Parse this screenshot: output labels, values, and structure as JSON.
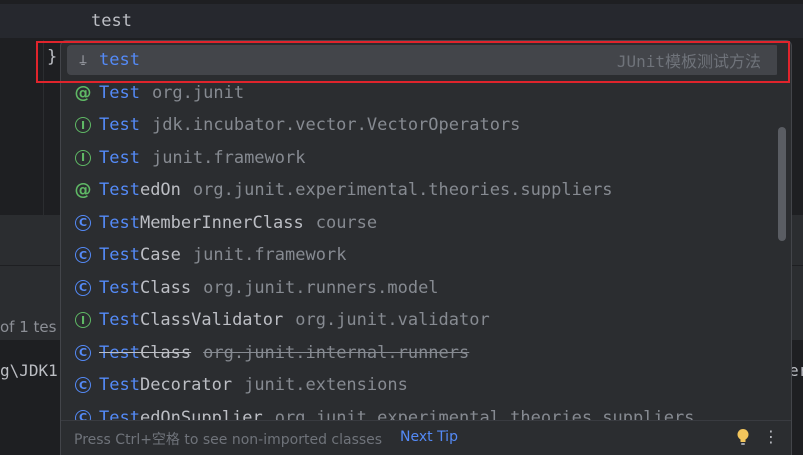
{
  "editor": {
    "typed_text": "test",
    "closing_brace": "}",
    "background_text_left": "of 1 tes",
    "background_path_text": "g\\JDK1",
    "background_text_right": "er"
  },
  "completion": {
    "items": [
      {
        "icon": "live-template-icon",
        "kind": "tmpl",
        "match": "test",
        "rest": "",
        "package": "",
        "hint": "JUnit模板测试方法",
        "selected": true,
        "deprecated": false
      },
      {
        "icon": "annotation-icon",
        "kind": "annot",
        "match": "Test",
        "rest": "",
        "package": "org.junit",
        "selected": false,
        "deprecated": false
      },
      {
        "icon": "interface-icon",
        "kind": "iface",
        "match": "Test",
        "rest": "",
        "package": "jdk.incubator.vector.VectorOperators",
        "selected": false,
        "deprecated": false
      },
      {
        "icon": "interface-icon",
        "kind": "iface",
        "match": "Test",
        "rest": "",
        "package": "junit.framework",
        "selected": false,
        "deprecated": false
      },
      {
        "icon": "annotation-icon",
        "kind": "annot",
        "match": "Test",
        "rest": "edOn",
        "package": "org.junit.experimental.theories.suppliers",
        "selected": false,
        "deprecated": false
      },
      {
        "icon": "class-icon",
        "kind": "class",
        "match": "Test",
        "rest": "MemberInnerClass",
        "package": "course",
        "selected": false,
        "deprecated": false
      },
      {
        "icon": "class-icon",
        "kind": "class",
        "match": "Test",
        "rest": "Case",
        "package": "junit.framework",
        "selected": false,
        "deprecated": false
      },
      {
        "icon": "class-icon",
        "kind": "class",
        "match": "Test",
        "rest": "Class",
        "package": "org.junit.runners.model",
        "selected": false,
        "deprecated": false
      },
      {
        "icon": "interface-icon",
        "kind": "iface",
        "match": "Test",
        "rest": "ClassValidator",
        "package": "org.junit.validator",
        "selected": false,
        "deprecated": false
      },
      {
        "icon": "class-icon",
        "kind": "class",
        "match": "Test",
        "rest": "Class",
        "package": "org.junit.internal.runners",
        "selected": false,
        "deprecated": true
      },
      {
        "icon": "class-icon",
        "kind": "class",
        "match": "Test",
        "rest": "Decorator",
        "package": "junit.extensions",
        "selected": false,
        "deprecated": false
      },
      {
        "icon": "class-icon",
        "kind": "class",
        "match": "Test",
        "rest": "edOnSupplier",
        "package": "org.junit.experimental.theories.suppliers",
        "selected": false,
        "deprecated": false
      }
    ],
    "footer": {
      "tip_text": "Press Ctrl+空格 to see non-imported classes",
      "next_tip_label": "Next Tip"
    },
    "icon_chars": {
      "class": "C",
      "iface": "I",
      "annot": "@",
      "tmpl": "⍊"
    }
  },
  "colors": {
    "match_highlight": "#548af7",
    "interface_icon": "#5fb865",
    "class_icon": "#548af7",
    "selection_outline": "#e0242c"
  }
}
